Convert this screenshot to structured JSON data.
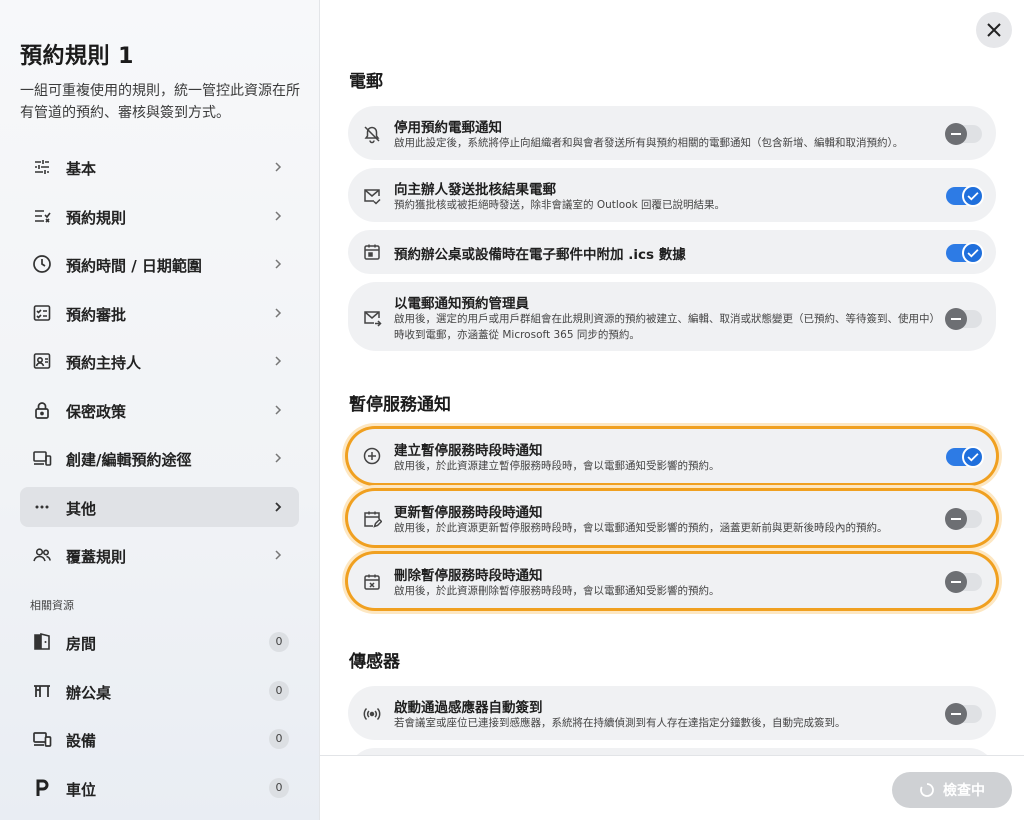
{
  "sidebar": {
    "title": "預約規則 1",
    "description": "一組可重複使用的規則，統一管控此資源在所有管道的預約、審核與簽到方式。",
    "items": [
      {
        "label": "基本",
        "icon": "sliders-icon"
      },
      {
        "label": "預約規則",
        "icon": "checklist-icon"
      },
      {
        "label": "預約時間 / 日期範圍",
        "icon": "clock-icon"
      },
      {
        "label": "預約審批",
        "icon": "approval-icon"
      },
      {
        "label": "預約主持人",
        "icon": "host-icon"
      },
      {
        "label": "保密政策",
        "icon": "lock-icon"
      },
      {
        "label": "創建/編輯預約途徑",
        "icon": "devices-icon"
      },
      {
        "label": "其他",
        "icon": "more-icon"
      },
      {
        "label": "覆蓋規則",
        "icon": "people-icon"
      }
    ],
    "resources_label": "相關資源",
    "resources": [
      {
        "label": "房間",
        "count": "0",
        "icon": "door-icon"
      },
      {
        "label": "辦公桌",
        "count": "0",
        "icon": "desk-icon"
      },
      {
        "label": "設備",
        "count": "0",
        "icon": "equipment-icon"
      },
      {
        "label": "車位",
        "count": "0",
        "icon": "parking-icon"
      }
    ]
  },
  "main": {
    "groups": [
      {
        "title": "電郵",
        "items": [
          {
            "title": "停用預約電郵通知",
            "desc": "啟用此設定後，系統將停止向組織者和與會者發送所有與預約相關的電郵通知（包含新增、編輯和取消預約）。",
            "enabled": false
          },
          {
            "title": "向主辦人發送批核結果電郵",
            "desc": "預約獲批核或被拒絕時發送，除非會議室的 Outlook 回覆已說明結果。",
            "enabled": true
          },
          {
            "title": "預約辦公桌或設備時在電子郵件中附加 .ics 數據",
            "desc": "",
            "enabled": true
          },
          {
            "title": "以電郵通知預約管理員",
            "desc": "啟用後，選定的用戶或用戶群組會在此規則資源的預約被建立、編輯、取消或狀態變更（已預約、等待簽到、使用中）時收到電郵，亦涵蓋從 Microsoft 365 同步的預約。",
            "enabled": false
          }
        ]
      },
      {
        "title": "暫停服務通知",
        "items": [
          {
            "title": "建立暫停服務時段時通知",
            "desc": "啟用後，於此資源建立暫停服務時段時，會以電郵通知受影響的預約。",
            "enabled": true
          },
          {
            "title": "更新暫停服務時段時通知",
            "desc": "啟用後，於此資源更新暫停服務時段時，會以電郵通知受影響的預約，涵蓋更新前與更新後時段內的預約。",
            "enabled": false
          },
          {
            "title": "刪除暫停服務時段時通知",
            "desc": "啟用後，於此資源刪除暫停服務時段時，會以電郵通知受影響的預約。",
            "enabled": false
          }
        ]
      },
      {
        "title": "傳感器",
        "items": [
          {
            "title": "啟動通過感應器自動簽到",
            "desc": "若會議室或座位已連接到感應器，系統將在持續偵測到有人存在達指定分鐘數後，自動完成簽到。",
            "enabled": false
          }
        ]
      }
    ]
  },
  "footer": {
    "check_label": "檢查中"
  },
  "colors": {
    "accent": "#2d7be5",
    "highlight": "#f0a020",
    "card_bg": "#f0f1f3"
  }
}
